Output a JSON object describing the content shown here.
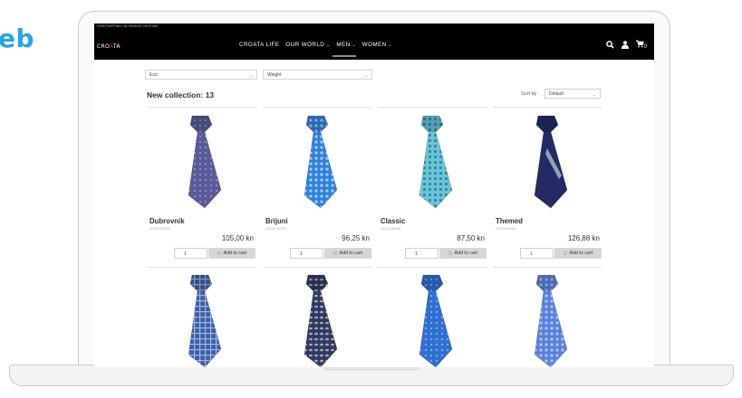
{
  "side_text": "eb",
  "promo": "FREE SHIPPING ON ORDERS OVER 500",
  "logo": {
    "left": "CRO",
    "mark": "A",
    "right": "TA"
  },
  "menu": [
    {
      "label": "CROATA LIFE",
      "has_dropdown": false
    },
    {
      "label": "OUR WORLD",
      "has_dropdown": true
    },
    {
      "label": "MEN",
      "has_dropdown": true
    },
    {
      "label": "WOMEN",
      "has_dropdown": true
    }
  ],
  "nav_icons": {
    "search": "search-icon",
    "account": "user-icon",
    "cart": "cart-icon",
    "cart_count": "0"
  },
  "filters": {
    "material": "Eco",
    "weight": "Weight"
  },
  "heading": "New collection: 13",
  "sort": {
    "label": "Sort by",
    "value": "Default"
  },
  "products": [
    {
      "name": "Dubrovnik",
      "sku": "010250-000025",
      "price": "105,00 kn",
      "qty": "1",
      "button": "Add to cart",
      "color": "#5a5a9a",
      "accent": "#9a8fc2",
      "pattern": "dots"
    },
    {
      "name": "Brijuni",
      "sku": "010201-000275",
      "price": "96,25 kn",
      "qty": "1",
      "button": "Add to cart",
      "color": "#2f7fd8",
      "accent": "#9fd0ff",
      "pattern": "squares"
    },
    {
      "name": "Classic",
      "sku": "010330-004060",
      "price": "87,50 kn",
      "qty": "1",
      "button": "Add to cart",
      "color": "#6ec3d6",
      "accent": "#2c8fb0",
      "pattern": "checks"
    },
    {
      "name": "Themed",
      "sku": "010100-004069",
      "price": "126,88 kn",
      "qty": "1",
      "button": "Add to cart",
      "color": "#232a66",
      "accent": "#8fa3b5",
      "pattern": "stripe"
    }
  ],
  "products_row2": [
    {
      "color": "#3d5fa8",
      "accent": "#9db7e0",
      "pattern": "plaid"
    },
    {
      "color": "#243a78",
      "accent": "#c9a36b",
      "pattern": "paisley"
    },
    {
      "color": "#2f6fd0",
      "accent": "#7fb0f0",
      "pattern": "dots"
    },
    {
      "color": "#5b7fd8",
      "accent": "#a9c4f7",
      "pattern": "squares"
    }
  ]
}
